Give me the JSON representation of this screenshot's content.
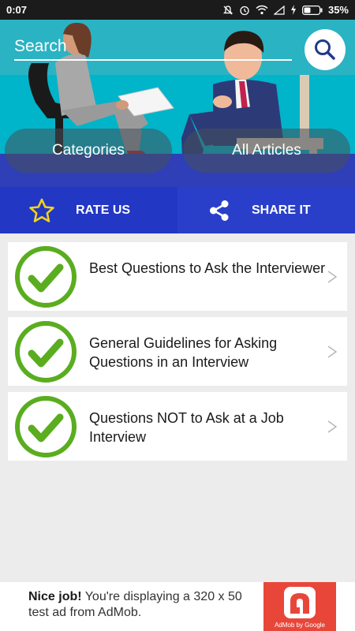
{
  "status_bar": {
    "time": "0:07",
    "battery": "35%"
  },
  "header": {
    "search_label": "Search",
    "tabs": [
      "Categories",
      "All Articles"
    ]
  },
  "actions": {
    "rate": "RATE US",
    "share": "SHARE IT"
  },
  "articles": [
    {
      "title": "Best Questions to Ask the Interviewer"
    },
    {
      "title": "General Guidelines for Asking Questions in an Interview"
    },
    {
      "title": "Questions NOT to Ask at a Job Interview"
    }
  ],
  "ad": {
    "headline": "Nice job!",
    "body": "You're displaying a 320 x 50 test ad from AdMob.",
    "logo_caption": "AdMob by Google"
  },
  "colors": {
    "header_teal": "#00b4c9",
    "action_blue": "#2237c4",
    "check_green": "#5aad1f",
    "ad_red": "#e9463a"
  },
  "icons": [
    "mute-icon",
    "alarm-icon",
    "wifi-icon",
    "signal-icon",
    "charging-icon",
    "battery-icon",
    "search-icon",
    "star-icon",
    "share-icon",
    "checkmark-icon",
    "chevron-right-icon"
  ]
}
